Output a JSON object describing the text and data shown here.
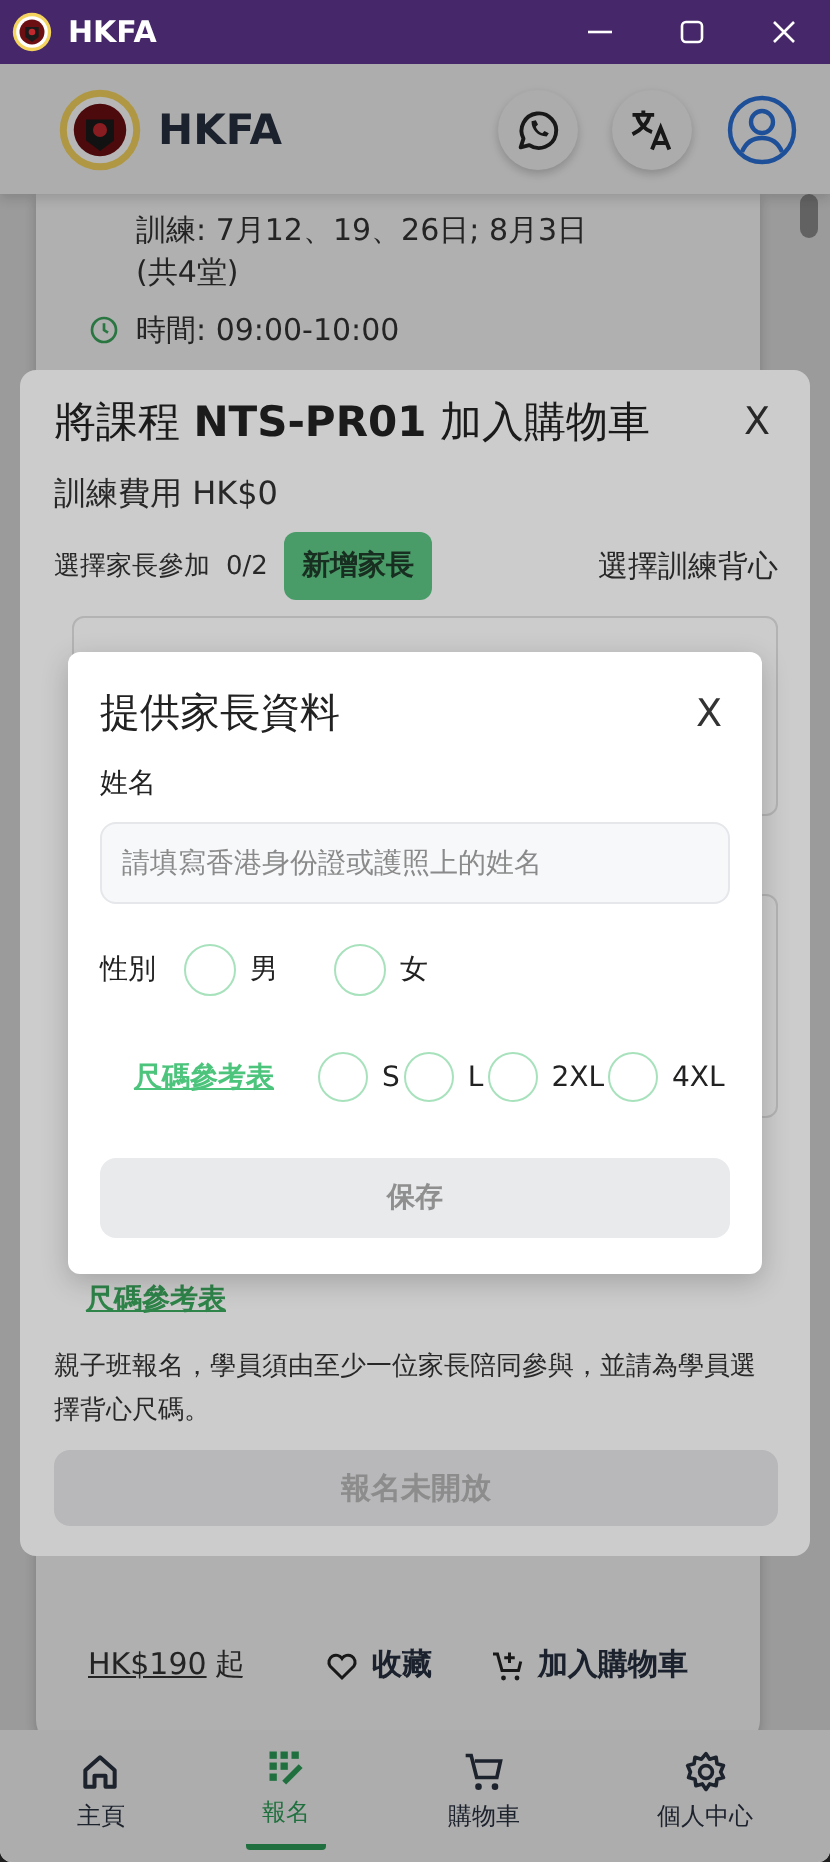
{
  "window": {
    "title": "HKFA"
  },
  "header": {
    "brand": "HKFA"
  },
  "course_card": {
    "lines": [
      {
        "kind": "plain",
        "text": "訓練: 7月12、19、26日; 8月3日"
      },
      {
        "kind": "plain",
        "text": "(共4堂)"
      },
      {
        "kind": "clock",
        "text": "時間: 09:00-10:00"
      }
    ],
    "price": "HK$190",
    "price_suffix": "起",
    "favorite": "收藏",
    "add_to_cart": "加入購物車"
  },
  "bottom_nav": [
    {
      "kind": "home",
      "label": "主頁",
      "selected": false
    },
    {
      "kind": "register",
      "label": "報名",
      "selected": true
    },
    {
      "kind": "cart",
      "label": "購物車",
      "selected": false
    },
    {
      "kind": "settings",
      "label": "個人中心",
      "selected": false
    }
  ],
  "cart_dialog": {
    "title": "將課程 **NTS-PR01** 加入購物車",
    "close": "X",
    "fee": "訓練費用 HK$0",
    "parents_label": "選擇家長參加",
    "parents_count": "0/2",
    "add_parent": "新增家長",
    "vest_label": "選擇訓練背心",
    "size_chart": "尺碼參考表",
    "note": "親子班報名，學員須由至少一位家長陪同參與，並請為學員選擇背心尺碼。",
    "submit": {
      "label": "報名未開放",
      "disabled": true
    }
  },
  "parent_dialog": {
    "title": "提供家長資料",
    "close": "X",
    "name_label": "姓名",
    "name_placeholder": "請填寫香港身份證或護照上的姓名",
    "gender_label": "性別",
    "genders": [
      {
        "label": "男",
        "selected": false
      },
      {
        "label": "女",
        "selected": false
      }
    ],
    "size_chart": "尺碼參考表",
    "sizes": [
      {
        "label": "S",
        "selected": false
      },
      {
        "label": "L",
        "selected": false
      },
      {
        "label": "2XL",
        "selected": false
      },
      {
        "label": "4XL",
        "selected": false
      }
    ],
    "save": {
      "label": "保存",
      "disabled": true
    }
  }
}
